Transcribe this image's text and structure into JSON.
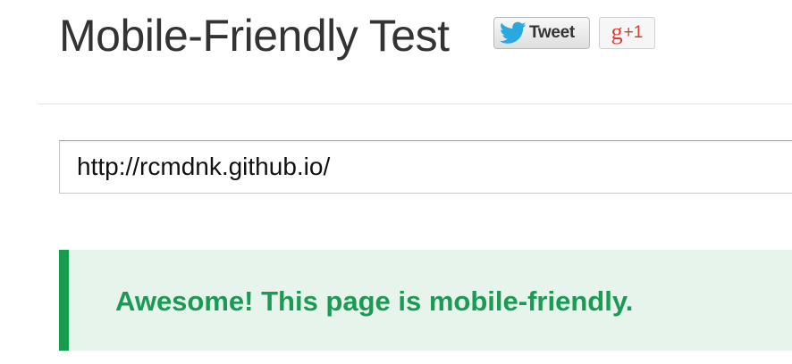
{
  "header": {
    "title": "Mobile-Friendly Test",
    "tweet_label": "Tweet",
    "gplus_letter": "g",
    "gplus_count": "+1"
  },
  "url_field": {
    "value": "http://rcmdnk.github.io/"
  },
  "result": {
    "message": "Awesome! This page is mobile-friendly."
  },
  "colors": {
    "success_accent": "#169b4f",
    "success_text": "#1a9a55",
    "success_background": "#e6f4ec",
    "twitter_blue": "#2aa9e0",
    "gplus_red": "#d73d32"
  },
  "icons": {
    "tweet": "twitter-bird-icon",
    "gplus": "google-plus-icon"
  }
}
